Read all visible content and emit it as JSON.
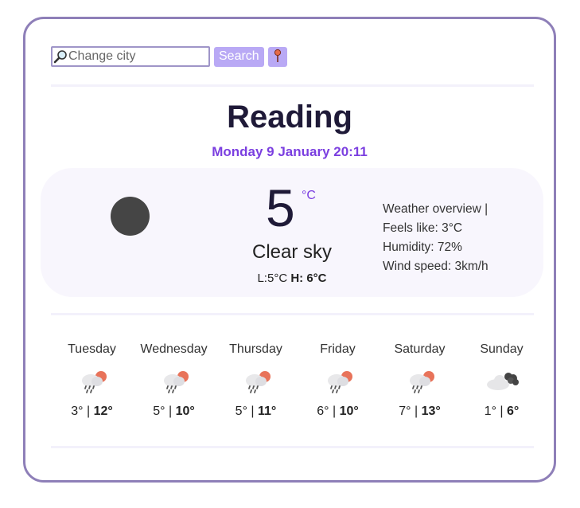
{
  "search": {
    "placeholder": "Change city",
    "button_label": "Search"
  },
  "city": "Reading",
  "datetime": "Monday 9 January 20:11",
  "current": {
    "temperature": "5",
    "unit": "°C",
    "description": "Clear sky",
    "low_label": "L:",
    "low": "5°C",
    "high_label": "H:",
    "high": "6°C"
  },
  "overview": {
    "title": "Weather overview |",
    "feels_like": "Feels like: 3°C",
    "humidity": "Humidity: 72%",
    "wind": "Wind speed: 3km/h"
  },
  "forecast": [
    {
      "day": "Tuesday",
      "low": "3°",
      "sep": " | ",
      "high": "12°",
      "icon": "rain-sun-icon"
    },
    {
      "day": "Wednesday",
      "low": "5°",
      "sep": " | ",
      "high": "10°",
      "icon": "rain-sun-icon"
    },
    {
      "day": "Thursday",
      "low": "5°",
      "sep": " | ",
      "high": "11°",
      "icon": "rain-sun-icon"
    },
    {
      "day": "Friday",
      "low": "6°",
      "sep": " | ",
      "high": "10°",
      "icon": "rain-sun-icon"
    },
    {
      "day": "Saturday",
      "low": "7°",
      "sep": " | ",
      "high": "13°",
      "icon": "rain-sun-icon"
    },
    {
      "day": "Sunday",
      "low": "1°",
      "sep": " | ",
      "high": "6°",
      "icon": "cloudy-icon"
    }
  ],
  "colors": {
    "accent": "#7b3fe0",
    "button": "#b9a9f5",
    "border": "#8e7fb8"
  }
}
